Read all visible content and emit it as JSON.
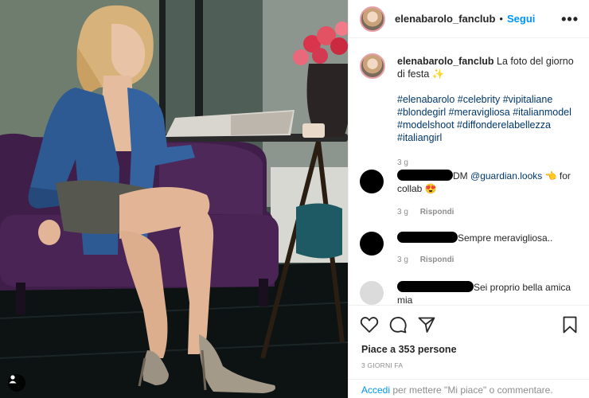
{
  "post": {
    "username": "elenabarolo_fanclub",
    "follow_separator": "•",
    "follow_label": "Segui",
    "more_icon": "more-options-icon",
    "caption_text": "La foto del giorno di festa",
    "caption_emoji": "✨",
    "hashtags": "#elenabarolo #celebrity #vipitaliane #blondegirl #meravigliosa #italianmodel #modelshoot #diffonderelabellezza #italiangirl",
    "caption_time": "3 g"
  },
  "comments": [
    {
      "text": "DM",
      "mention": "@guardian.looks",
      "text_after": "👈 for collab 😍",
      "time": "3 g",
      "reply_label": "Rispondi"
    },
    {
      "text": "Sempre meravigliosa..",
      "time": "3 g",
      "reply_label": "Rispondi"
    },
    {
      "text": "Sei proprio bella amica mia"
    }
  ],
  "actions": {
    "likes": "Piace a 353 persone",
    "date": "3 GIORNI FA",
    "login_link": "Accedi",
    "login_text": " per mettere \"Mi piace\" o commentare."
  },
  "colors": {
    "accent": "#0095f6",
    "hashtag": "#00376b",
    "muted": "#8e8e8e",
    "text": "#262626"
  }
}
